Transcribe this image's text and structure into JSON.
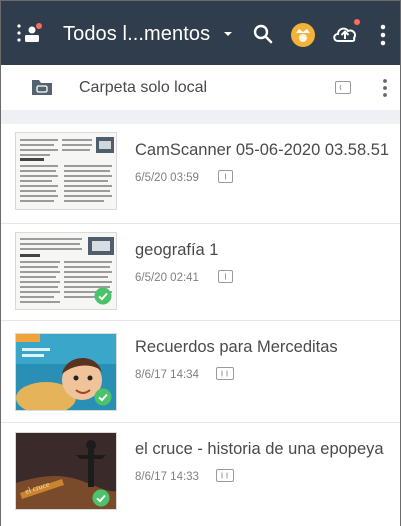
{
  "toolbar": {
    "title": "Todos l...mentos",
    "icons": [
      "menu-icon",
      "chevron-down-icon",
      "search-icon",
      "premium-avatar-icon",
      "cloud-upload-icon",
      "more-vert-icon"
    ],
    "colors": {
      "background": "#2f3d4c",
      "notification_dot": "#ff6b5a",
      "avatar": "#f3b33a"
    }
  },
  "folder": {
    "label": "Carpeta solo local",
    "icons": [
      "local-folder-icon",
      "page-count-icon",
      "more-vert-icon"
    ]
  },
  "documents": [
    {
      "title": "CamScanner 05-06-2020 03.58.51",
      "date": "6/5/20 03:59",
      "synced": false
    },
    {
      "title": "geografía 1",
      "date": "6/5/20 02:41",
      "synced": true
    },
    {
      "title": "Recuerdos para Merceditas",
      "date": "8/6/17 14:34",
      "synced": true
    },
    {
      "title": "el cruce - historia de una epopeya",
      "date": "8/6/17 14:33",
      "synced": true
    }
  ],
  "colors": {
    "sync_check": "#4cc36b",
    "list_background": "#ffffff",
    "separator": "#eef0f3"
  }
}
